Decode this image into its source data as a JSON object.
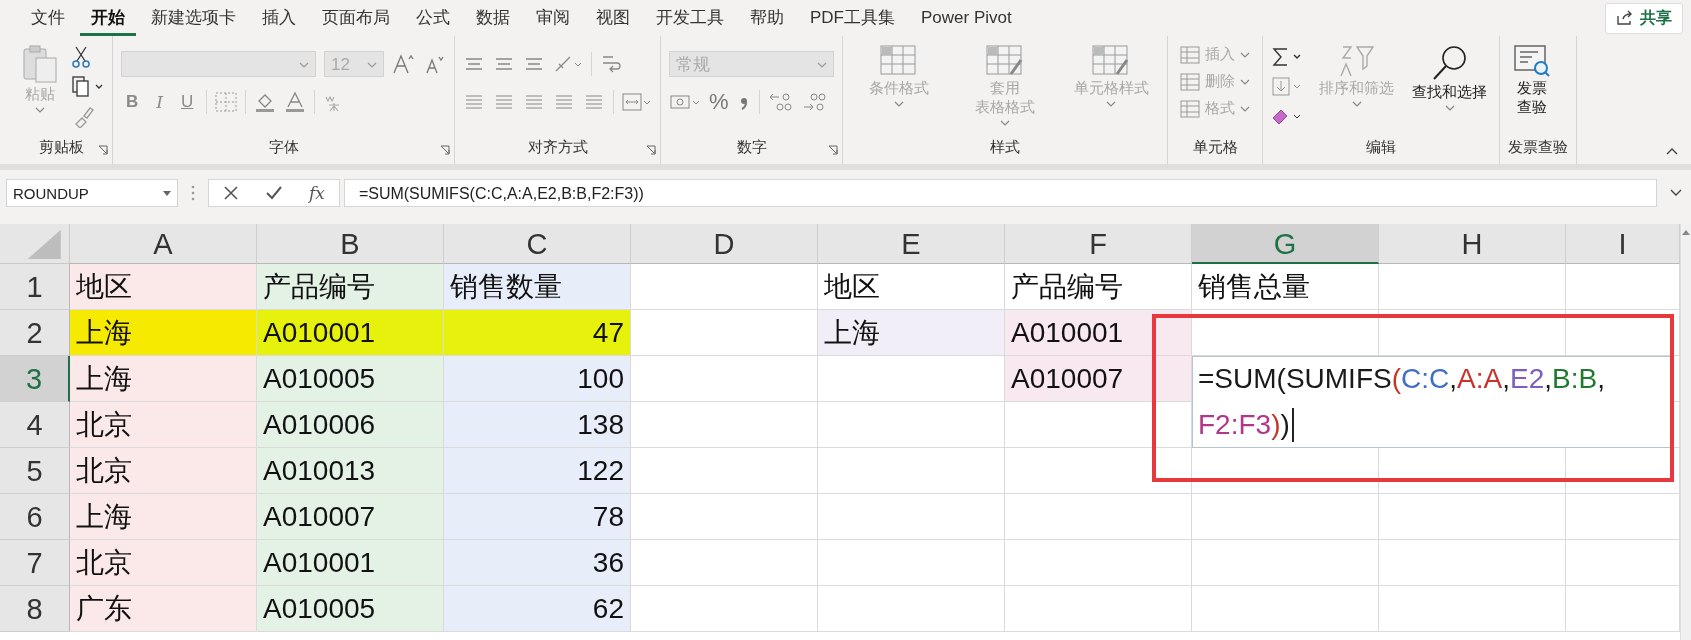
{
  "tabs": [
    {
      "label": "文件",
      "selected": false
    },
    {
      "label": "开始",
      "selected": true
    },
    {
      "label": "新建选项卡",
      "selected": false
    },
    {
      "label": "插入",
      "selected": false
    },
    {
      "label": "页面布局",
      "selected": false
    },
    {
      "label": "公式",
      "selected": false
    },
    {
      "label": "数据",
      "selected": false
    },
    {
      "label": "审阅",
      "selected": false
    },
    {
      "label": "视图",
      "selected": false
    },
    {
      "label": "开发工具",
      "selected": false
    },
    {
      "label": "帮助",
      "selected": false
    },
    {
      "label": "PDF工具集",
      "selected": false
    },
    {
      "label": "Power Pivot",
      "selected": false
    }
  ],
  "share_button": "共享",
  "ribbon": {
    "clipboard": {
      "label": "剪贴板",
      "paste": {
        "label": "粘贴",
        "disabled": true
      }
    },
    "font": {
      "label": "字体",
      "font_size": "12",
      "format_buttons": [
        "B",
        "I",
        "U"
      ]
    },
    "alignment": {
      "label": "对齐方式"
    },
    "number": {
      "label": "数字",
      "format": "常规",
      "percent": "%"
    },
    "styles": {
      "label": "样式",
      "buttons": [
        {
          "lines": [
            "条件格式"
          ],
          "disabled": true
        },
        {
          "lines": [
            "套用",
            "表格格式"
          ],
          "disabled": true
        },
        {
          "lines": [
            "单元格样式"
          ],
          "disabled": true
        }
      ]
    },
    "cells": {
      "label": "单元格",
      "buttons": [
        {
          "label": "插入",
          "disabled": true
        },
        {
          "label": "删除",
          "disabled": true
        },
        {
          "label": "格式",
          "disabled": true
        }
      ]
    },
    "editing": {
      "label": "编辑",
      "buttons": [
        {
          "label": "排序和筛选",
          "disabled": true
        },
        {
          "label": "查找和选择",
          "disabled": false
        }
      ]
    },
    "invoice": {
      "label": "发票查验",
      "button": {
        "lines": [
          "发票",
          "查验"
        ]
      }
    }
  },
  "name_box": "ROUNDUP",
  "fx": "fx",
  "formula": "=SUM(SUMIFS(C:C,A:A,E2,B:B,F2:F3))",
  "columns": [
    {
      "label": "A",
      "selected": false,
      "color": "#fbe9ea"
    },
    {
      "label": "B",
      "selected": false,
      "color": "#e3f2e5"
    },
    {
      "label": "C",
      "selected": false,
      "color": "#e8eef9"
    },
    {
      "label": "D",
      "selected": false
    },
    {
      "label": "E",
      "selected": false
    },
    {
      "label": "F",
      "selected": false
    },
    {
      "label": "G",
      "selected": true
    },
    {
      "label": "H",
      "selected": false
    },
    {
      "label": "I",
      "selected": false
    }
  ],
  "rows": [
    {
      "number": "1",
      "selected": false,
      "highlighted": false,
      "cells": [
        {
          "text": "地区"
        },
        {
          "text": "产品编号"
        },
        {
          "text": "销售数量"
        },
        null,
        {
          "text": "地区"
        },
        {
          "text": "产品编号"
        },
        {
          "text": "销售总量"
        },
        null,
        null
      ]
    },
    {
      "number": "2",
      "selected": false,
      "highlighted": true,
      "cells": [
        {
          "text": "上海"
        },
        {
          "text": "A010001"
        },
        {
          "text": "47",
          "kind": "number"
        },
        null,
        {
          "text": "上海",
          "color": "#f2eef8"
        },
        {
          "text": "A010001",
          "color": "#f8e9f1"
        },
        null,
        null,
        null
      ]
    },
    {
      "number": "3",
      "selected": true,
      "highlighted": false,
      "cells": [
        {
          "text": "上海"
        },
        {
          "text": "A010005"
        },
        {
          "text": "100",
          "kind": "number"
        },
        null,
        null,
        {
          "text": "A010007",
          "color": "#f8e9f1"
        },
        null,
        null,
        null
      ]
    },
    {
      "number": "4",
      "selected": false,
      "highlighted": false,
      "cells": [
        {
          "text": "北京"
        },
        {
          "text": "A010006"
        },
        {
          "text": "138",
          "kind": "number"
        },
        null,
        null,
        null,
        null,
        null,
        null
      ]
    },
    {
      "number": "5",
      "selected": false,
      "highlighted": false,
      "cells": [
        {
          "text": "北京"
        },
        {
          "text": "A010013"
        },
        {
          "text": "122",
          "kind": "number"
        },
        null,
        null,
        null,
        null,
        null,
        null
      ]
    },
    {
      "number": "6",
      "selected": false,
      "highlighted": false,
      "cells": [
        {
          "text": "上海"
        },
        {
          "text": "A010007"
        },
        {
          "text": "78",
          "kind": "number"
        },
        null,
        null,
        null,
        null,
        null,
        null
      ]
    },
    {
      "number": "7",
      "selected": false,
      "highlighted": false,
      "cells": [
        {
          "text": "北京"
        },
        {
          "text": "A010001"
        },
        {
          "text": "36",
          "kind": "number"
        },
        null,
        null,
        null,
        null,
        null,
        null
      ]
    },
    {
      "number": "8",
      "selected": false,
      "highlighted": false,
      "cells": [
        {
          "text": "广东"
        },
        {
          "text": "A010005"
        },
        {
          "text": "62",
          "kind": "number"
        },
        null,
        null,
        null,
        null,
        null,
        null
      ]
    }
  ],
  "editor": {
    "lines": [
      [
        {
          "text": "=SUM(SUMIFS",
          "color": "#1a1a1a"
        },
        {
          "text": "(",
          "color": "#c0392b"
        },
        {
          "text": "C:C",
          "color": "#3d6fc4"
        },
        {
          "text": ",",
          "color": "#1a1a1a"
        },
        {
          "text": "A:A",
          "color": "#c8332e"
        },
        {
          "text": ",",
          "color": "#1a1a1a"
        },
        {
          "text": "E2",
          "color": "#7e5cc0"
        },
        {
          "text": ",",
          "color": "#1a1a1a"
        },
        {
          "text": "B:B",
          "color": "#1f7a2e"
        },
        {
          "text": ",",
          "color": "#1a1a1a"
        }
      ],
      [
        {
          "text": "F2:F3",
          "color": "#b0378a"
        },
        {
          "text": ")",
          "color": "#c0392b"
        },
        {
          "text": ")",
          "color": "#1a1a1a"
        }
      ]
    ]
  }
}
